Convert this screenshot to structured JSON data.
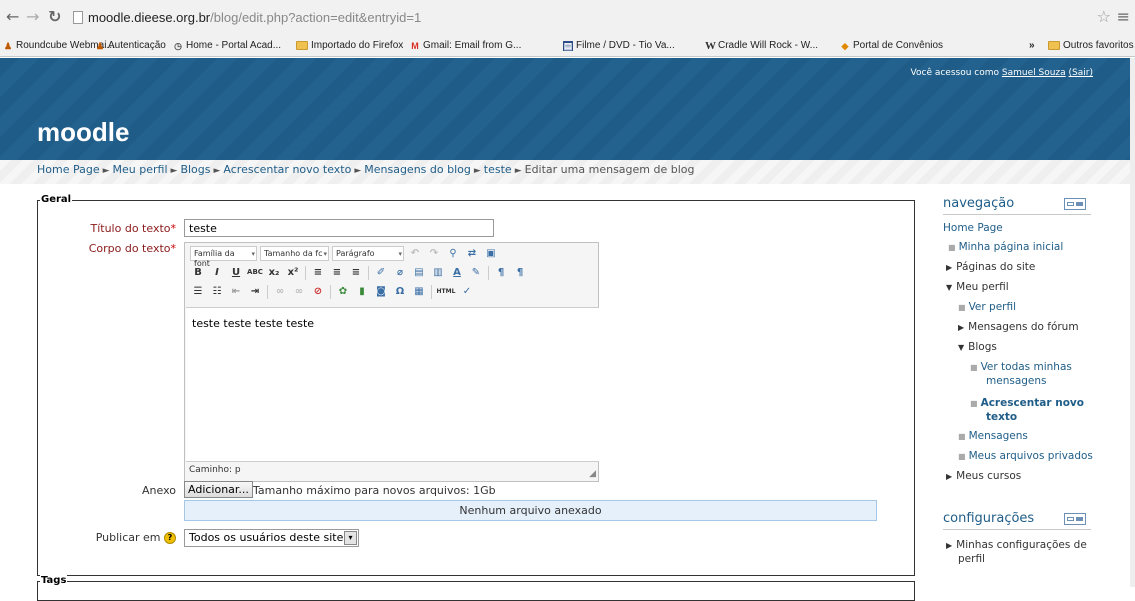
{
  "browser": {
    "url_host": "moodle.dieese.org.br",
    "url_path": "/blog/edit.php?action=edit&entryid=1",
    "bookmarks": [
      "Roundcube Webmai...",
      "Autenticação",
      "Home - Portal Acad...",
      "Importado do Firefox",
      "Gmail: Email from G...",
      "Filme / DVD - Tio Va...",
      "Cradle Will Rock - W...",
      "Portal de Convênios"
    ],
    "overflow": "»",
    "other_bookmarks": "Outros favoritos"
  },
  "header": {
    "logo": "moodle",
    "login_prefix": "Você acessou como",
    "user": "Samuel Souza",
    "logout": "(Sair)"
  },
  "breadcrumb": [
    "Home Page",
    "Meu perfil",
    "Blogs",
    "Acrescentar novo texto",
    "Mensagens do blog",
    "teste",
    "Editar uma mensagem de blog"
  ],
  "form": {
    "legend_general": "Geral",
    "title_label": "Título do texto",
    "title_value": "teste",
    "body_label": "Corpo do texto",
    "font_family": "Família da font",
    "font_size": "Tamanho da fc",
    "paragraph": "Parágrafo",
    "body_text": "teste teste teste teste",
    "path": "Caminho: p",
    "attachment_label": "Anexo",
    "add_button": "Adicionar...",
    "max_size": "Tamanho máximo para novos arquivos: 1Gb",
    "no_file": "Nenhum arquivo anexado",
    "publish_label": "Publicar em",
    "publish_value": "Todos os usuários deste site",
    "legend_tags": "Tags"
  },
  "sidebar": {
    "nav_title": "navegação",
    "nav_items": {
      "home": "Home Page",
      "my_home": "Minha página inicial",
      "site_pages": "Páginas do site",
      "my_profile": "Meu perfil",
      "view_profile": "Ver perfil",
      "forum_posts": "Mensagens do fórum",
      "blogs": "Blogs",
      "view_all_1": "Ver todas minhas",
      "view_all_2": "mensagens",
      "add_new_1": "Acrescentar novo",
      "add_new_2": "texto",
      "messages": "Mensagens",
      "private_files": "Meus arquivos privados",
      "my_courses": "Meus cursos"
    },
    "settings_title": "configurações",
    "settings_1": "Minhas configurações de",
    "settings_2": "perfil"
  }
}
